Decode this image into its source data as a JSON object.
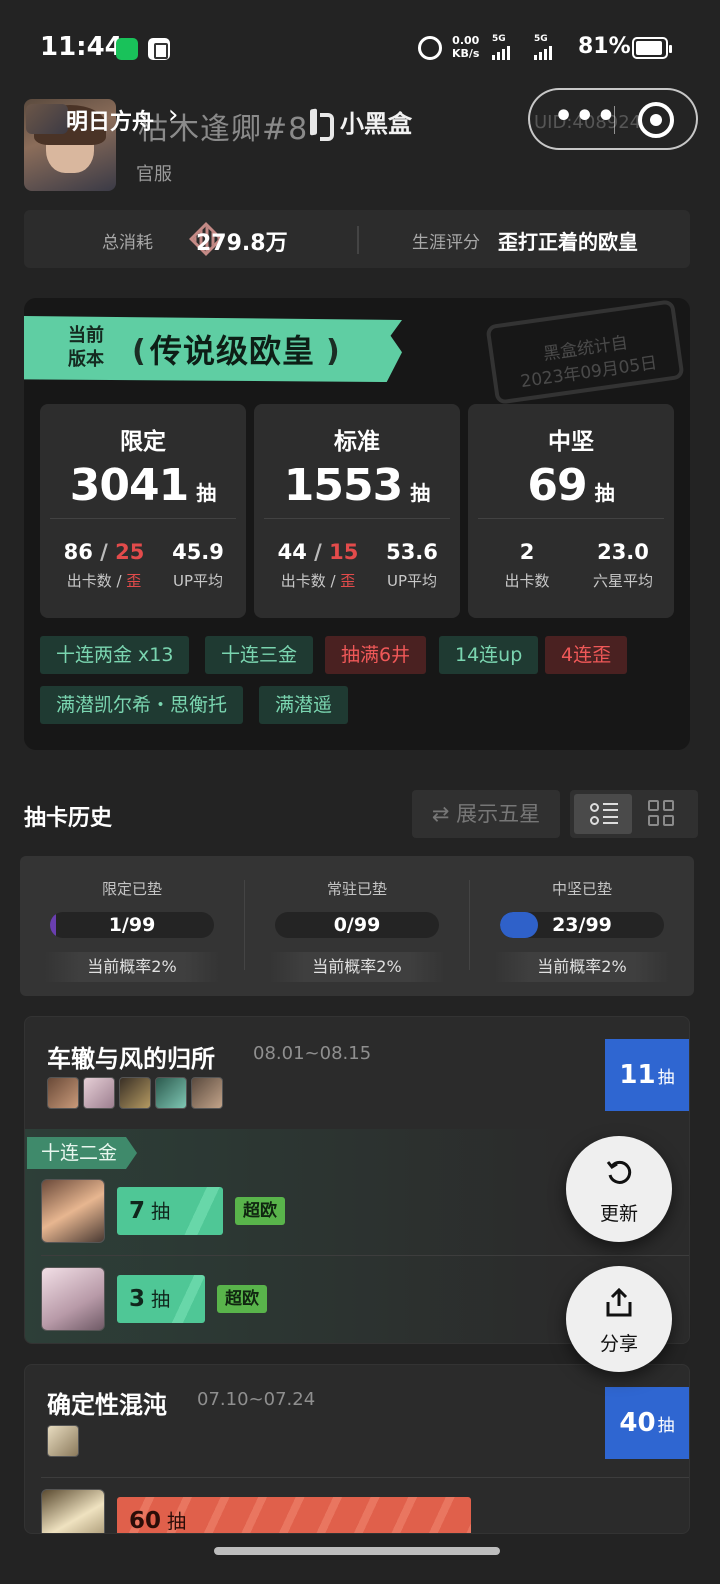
{
  "status_bar": {
    "time": "11:44",
    "net_speed": "0.00",
    "net_unit": "KB/s",
    "sig1": "5G",
    "sig2": "5G",
    "battery": "81%"
  },
  "header": {
    "game_name": "明日方舟",
    "user_name": "枯木逢卿#8",
    "uid": "UID:408924",
    "server": "官服",
    "brand": "小黑盒"
  },
  "summary": {
    "total_label": "总消耗",
    "total_value": "279.8万",
    "rating_label": "生涯评分",
    "rating_value": "歪打正着的欧皇"
  },
  "card": {
    "ribbon_small_1": "当前",
    "ribbon_small_2": "版本",
    "ribbon_title": "传说级欧皇",
    "stamp_line1": "黑盒统计自",
    "stamp_line2": "2023年09月05日",
    "pull_unit": "抽",
    "stats": [
      {
        "title": "限定",
        "pulls": "3041",
        "a_val": "86",
        "a_sep": " / ",
        "a_red": "25",
        "a_lbl": "出卡数",
        "a_lbl_sep": " / ",
        "a_lbl_red": "歪",
        "b_val": "45.9",
        "b_lbl": "UP平均"
      },
      {
        "title": "标准",
        "pulls": "1553",
        "a_val": "44",
        "a_sep": " / ",
        "a_red": "15",
        "a_lbl": "出卡数",
        "a_lbl_sep": " / ",
        "a_lbl_red": "歪",
        "b_val": "53.6",
        "b_lbl": "UP平均"
      },
      {
        "title": "中坚",
        "pulls": "69",
        "a_val": "2",
        "a_lbl": "出卡数",
        "b_val": "23.0",
        "b_lbl": "六星平均"
      }
    ],
    "tags": [
      "十连两金  x13",
      "十连三金",
      "抽满6井",
      "14连up",
      "4连歪",
      "满潜凯尔希・思衡托",
      "满潜遥"
    ]
  },
  "history": {
    "title": "抽卡历史",
    "show5": "⇄ 展示五星",
    "pity": [
      {
        "label": "限定已垫",
        "value": "1/99",
        "fraction": 0.01,
        "prob": "当前概率2%"
      },
      {
        "label": "常驻已垫",
        "value": "0/99",
        "fraction": 0.0,
        "prob": "当前概率2%"
      },
      {
        "label": "中坚已垫",
        "value": "23/99",
        "fraction": 0.23,
        "prob": "当前概率2%"
      }
    ]
  },
  "banners": [
    {
      "title": "车辙与风的归所",
      "date": "08.01~08.15",
      "pulls": "11",
      "unit": "抽",
      "tag": "十连二金",
      "rows": [
        {
          "num": "7",
          "unit": "抽",
          "label": "超欧"
        },
        {
          "num": "3",
          "unit": "抽",
          "label": "超欧"
        }
      ]
    },
    {
      "title": "确定性混沌",
      "date": "07.10~07.24",
      "pulls": "40",
      "unit": "抽",
      "rows": [
        {
          "num": "60",
          "unit": "抽"
        }
      ]
    }
  ],
  "fabs": {
    "refresh": "更新",
    "share": "分享"
  }
}
